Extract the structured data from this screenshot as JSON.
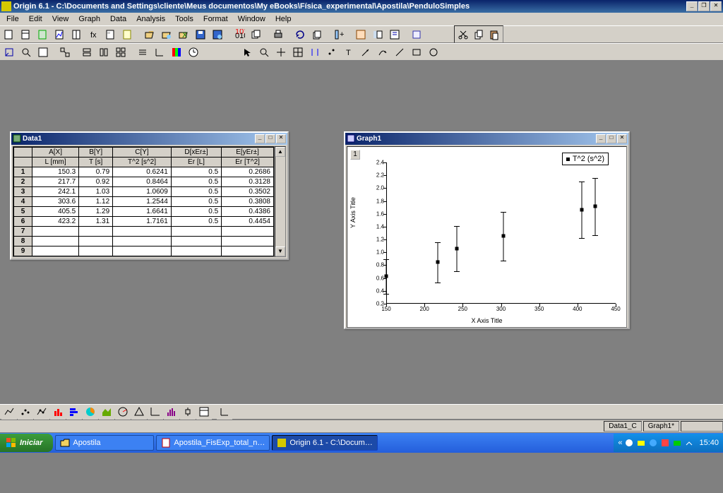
{
  "app": {
    "title": "Origin 6.1 - C:\\Documents and Settings\\cliente\\Meus documentos\\My eBooks\\Física_experimental\\Apostila\\PenduloSimples"
  },
  "menu": [
    "File",
    "Edit",
    "View",
    "Graph",
    "Data",
    "Analysis",
    "Tools",
    "Format",
    "Window",
    "Help"
  ],
  "data_window": {
    "title": "Data1",
    "col_headers_top": [
      "A[X]",
      "B[Y]",
      "C[Y]",
      "D[xEr±]",
      "E[yEr±]"
    ],
    "col_headers_sub": [
      "L [mm]",
      "T [s]",
      "T^2 [s^2]",
      "Er [L]",
      "Er [T^2]"
    ],
    "rows": [
      {
        "n": "1",
        "a": "150.3",
        "b": "0.79",
        "c": "0.6241",
        "d": "0.5",
        "e": "0.2686"
      },
      {
        "n": "2",
        "a": "217.7",
        "b": "0.92",
        "c": "0.8464",
        "d": "0.5",
        "e": "0.3128"
      },
      {
        "n": "3",
        "a": "242.1",
        "b": "1.03",
        "c": "1.0609",
        "d": "0.5",
        "e": "0.3502"
      },
      {
        "n": "4",
        "a": "303.6",
        "b": "1.12",
        "c": "1.2544",
        "d": "0.5",
        "e": "0.3808"
      },
      {
        "n": "5",
        "a": "405.5",
        "b": "1.29",
        "c": "1.6641",
        "d": "0.5",
        "e": "0.4386"
      },
      {
        "n": "6",
        "a": "423.2",
        "b": "1.31",
        "c": "1.7161",
        "d": "0.5",
        "e": "0.4454"
      }
    ],
    "empty_rows": [
      "7",
      "8",
      "9"
    ]
  },
  "graph_window": {
    "title": "Graph1",
    "layer": "1",
    "legend": "T^2 (s^2)",
    "xaxis_title": "X Axis Title",
    "yaxis_title": "Y Axis Title"
  },
  "chart_data": {
    "type": "scatter",
    "title": "",
    "xlabel": "X Axis Title",
    "ylabel": "Y Axis Title",
    "legend": [
      "T^2 (s^2)"
    ],
    "x": [
      150.3,
      217.7,
      242.1,
      303.6,
      405.5,
      423.2
    ],
    "y": [
      0.6241,
      0.8464,
      1.0609,
      1.2544,
      1.6641,
      1.7161
    ],
    "yerr": [
      0.2686,
      0.3128,
      0.3502,
      0.3808,
      0.4386,
      0.4454
    ],
    "xerr": [
      0.5,
      0.5,
      0.5,
      0.5,
      0.5,
      0.5
    ],
    "xlim": [
      150,
      450
    ],
    "ylim": [
      0.2,
      2.4
    ],
    "xticks": [
      150,
      200,
      250,
      300,
      350,
      400,
      450
    ],
    "yticks": [
      0.2,
      0.4,
      0.6,
      0.8,
      1.0,
      1.2,
      1.4,
      1.6,
      1.8,
      2.0,
      2.2,
      2.4
    ]
  },
  "status": {
    "left": "",
    "cells": [
      "Data1_C",
      "Graph1*"
    ]
  },
  "taskbar": {
    "start": "Iniciar",
    "buttons": [
      {
        "label": "Apostila"
      },
      {
        "label": "Apostila_FisExp_total_n…"
      },
      {
        "label": "Origin 6.1 - C:\\Docum…",
        "active": true
      }
    ],
    "clock": "15:40",
    "tray_chev": "«"
  }
}
